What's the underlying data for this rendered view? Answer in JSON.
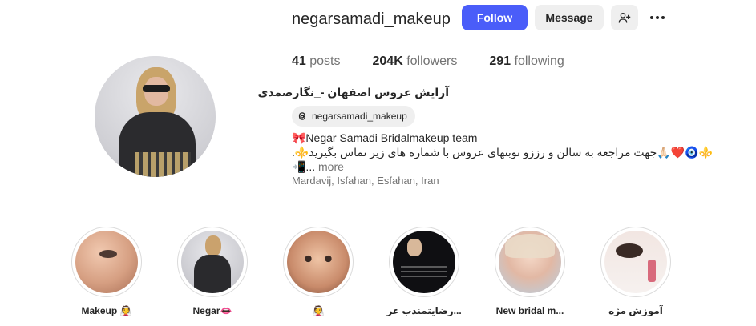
{
  "profile": {
    "username": "negarsamadi_makeup",
    "follow_label": "Follow",
    "message_label": "Message",
    "add_user_icon": "person-add-icon",
    "more_icon": "more-options-icon",
    "posts_count": "41",
    "posts_label": "posts",
    "followers_count": "204K",
    "followers_label": "followers",
    "following_count": "291",
    "following_label": "following",
    "full_name": "آرایش عروس اصفهان -_نگارصمدی",
    "threads_handle": "negarsamadi_makeup",
    "bio_line1": "🎀Negar Samadi Bridalmakeup team",
    "bio_line2": "⚜️🧿❤️🙏🏻جهت مراجعه به سالن و رززو نوبتهای عروس با شماره های زیر تماس بگیرید⚜️.",
    "bio_line3_prefix": "📲...",
    "bio_more": "more",
    "location": "Mardavij, Isfahan, Esfahan, Iran"
  },
  "highlights": [
    {
      "label": "Makeup 👰"
    },
    {
      "label": "Negar👄"
    },
    {
      "label": "👰"
    },
    {
      "label": "رضایتمندب عر..."
    },
    {
      "label": "New bridal m..."
    },
    {
      "label": "آموزش مژه"
    }
  ],
  "colors": {
    "accent": "#4a5df9",
    "secondary_button": "#efefef",
    "muted_text": "#737373"
  }
}
